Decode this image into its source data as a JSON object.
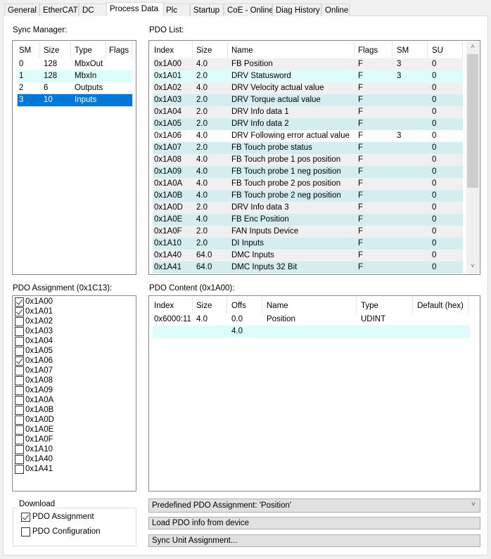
{
  "tabs": [
    "General",
    "EtherCAT",
    "DC",
    "Process Data",
    "Plc",
    "Startup",
    "CoE - Online",
    "Diag History",
    "Online"
  ],
  "selected_tab": "Process Data",
  "sync_manager": {
    "label": "Sync Manager:",
    "columns": [
      "SM",
      "Size",
      "Type",
      "Flags"
    ],
    "rows": [
      [
        "0",
        "128",
        "MbxOut",
        ""
      ],
      [
        "1",
        "128",
        "MbxIn",
        ""
      ],
      [
        "2",
        "6",
        "Outputs",
        ""
      ],
      [
        "3",
        "10",
        "Inputs",
        ""
      ]
    ],
    "selected_row": 3
  },
  "pdo_list": {
    "label": "PDO List:",
    "columns": [
      "Index",
      "Size",
      "Name",
      "Flags",
      "SM",
      "SU"
    ],
    "rows": [
      [
        "0x1A00",
        "4.0",
        "FB Position",
        "F",
        "3",
        "0"
      ],
      [
        "0x1A01",
        "2.0",
        "DRV Statusword",
        "F",
        "3",
        "0"
      ],
      [
        "0x1A02",
        "4.0",
        "DRV Velocity actual value",
        "F",
        "",
        "0"
      ],
      [
        "0x1A03",
        "2.0",
        "DRV Torque actual value",
        "F",
        "",
        "0"
      ],
      [
        "0x1A04",
        "2.0",
        "DRV Info data 1",
        "F",
        "",
        "0"
      ],
      [
        "0x1A05",
        "2.0",
        "DRV Info data 2",
        "F",
        "",
        "0"
      ],
      [
        "0x1A06",
        "4.0",
        "DRV Following error actual value",
        "F",
        "3",
        "0"
      ],
      [
        "0x1A07",
        "2.0",
        "FB Touch probe status",
        "F",
        "",
        "0"
      ],
      [
        "0x1A08",
        "4.0",
        "FB Touch probe 1 pos position",
        "F",
        "",
        "0"
      ],
      [
        "0x1A09",
        "4.0",
        "FB Touch probe 1 neg position",
        "F",
        "",
        "0"
      ],
      [
        "0x1A0A",
        "4.0",
        "FB Touch probe 2 pos position",
        "F",
        "",
        "0"
      ],
      [
        "0x1A0B",
        "4.0",
        "FB Touch probe 2 neg position",
        "F",
        "",
        "0"
      ],
      [
        "0x1A0D",
        "2.0",
        "DRV Info data 3",
        "F",
        "",
        "0"
      ],
      [
        "0x1A0E",
        "4.0",
        "FB Enc Position",
        "F",
        "",
        "0"
      ],
      [
        "0x1A0F",
        "2.0",
        "FAN Inputs Device",
        "F",
        "",
        "0"
      ],
      [
        "0x1A10",
        "2.0",
        "DI Inputs",
        "F",
        "",
        "0"
      ],
      [
        "0x1A40",
        "64.0",
        "DMC Inputs",
        "F",
        "",
        "0"
      ],
      [
        "0x1A41",
        "64.0",
        "DMC Inputs 32 Bit",
        "F",
        "",
        "0"
      ]
    ]
  },
  "pdo_assignment": {
    "label": "PDO Assignment (0x1C13):",
    "items": [
      {
        "label": "0x1A00",
        "checked": true
      },
      {
        "label": "0x1A01",
        "checked": true
      },
      {
        "label": "0x1A02",
        "checked": false
      },
      {
        "label": "0x1A03",
        "checked": false
      },
      {
        "label": "0x1A04",
        "checked": false
      },
      {
        "label": "0x1A05",
        "checked": false
      },
      {
        "label": "0x1A06",
        "checked": true
      },
      {
        "label": "0x1A07",
        "checked": false
      },
      {
        "label": "0x1A08",
        "checked": false
      },
      {
        "label": "0x1A09",
        "checked": false
      },
      {
        "label": "0x1A0A",
        "checked": false
      },
      {
        "label": "0x1A0B",
        "checked": false
      },
      {
        "label": "0x1A0D",
        "checked": false
      },
      {
        "label": "0x1A0E",
        "checked": false
      },
      {
        "label": "0x1A0F",
        "checked": false
      },
      {
        "label": "0x1A10",
        "checked": false
      },
      {
        "label": "0x1A40",
        "checked": false
      },
      {
        "label": "0x1A41",
        "checked": false
      }
    ]
  },
  "pdo_content": {
    "label": "PDO Content (0x1A00):",
    "columns": [
      "Index",
      "Size",
      "Offs",
      "Name",
      "Type",
      "Default (hex)"
    ],
    "rows": [
      [
        "0x6000:11",
        "4.0",
        "0.0",
        "Position",
        "UDINT",
        ""
      ],
      [
        "",
        "",
        "4.0",
        "",
        "",
        ""
      ]
    ]
  },
  "download": {
    "label": "Download",
    "pdo_assignment": {
      "label": "PDO Assignment",
      "checked": true
    },
    "pdo_configuration": {
      "label": "PDO Configuration",
      "checked": false
    }
  },
  "predefined_combo": "Predefined PDO Assignment: 'Position'",
  "load_button": "Load PDO info from device",
  "sync_unit_button": "Sync Unit Assignment...",
  "colors": {
    "selected": "#0078d7",
    "row_gray": "#f0f0f0",
    "row_cyan": "#d4eef0",
    "row_light": "#ddfdfd"
  }
}
